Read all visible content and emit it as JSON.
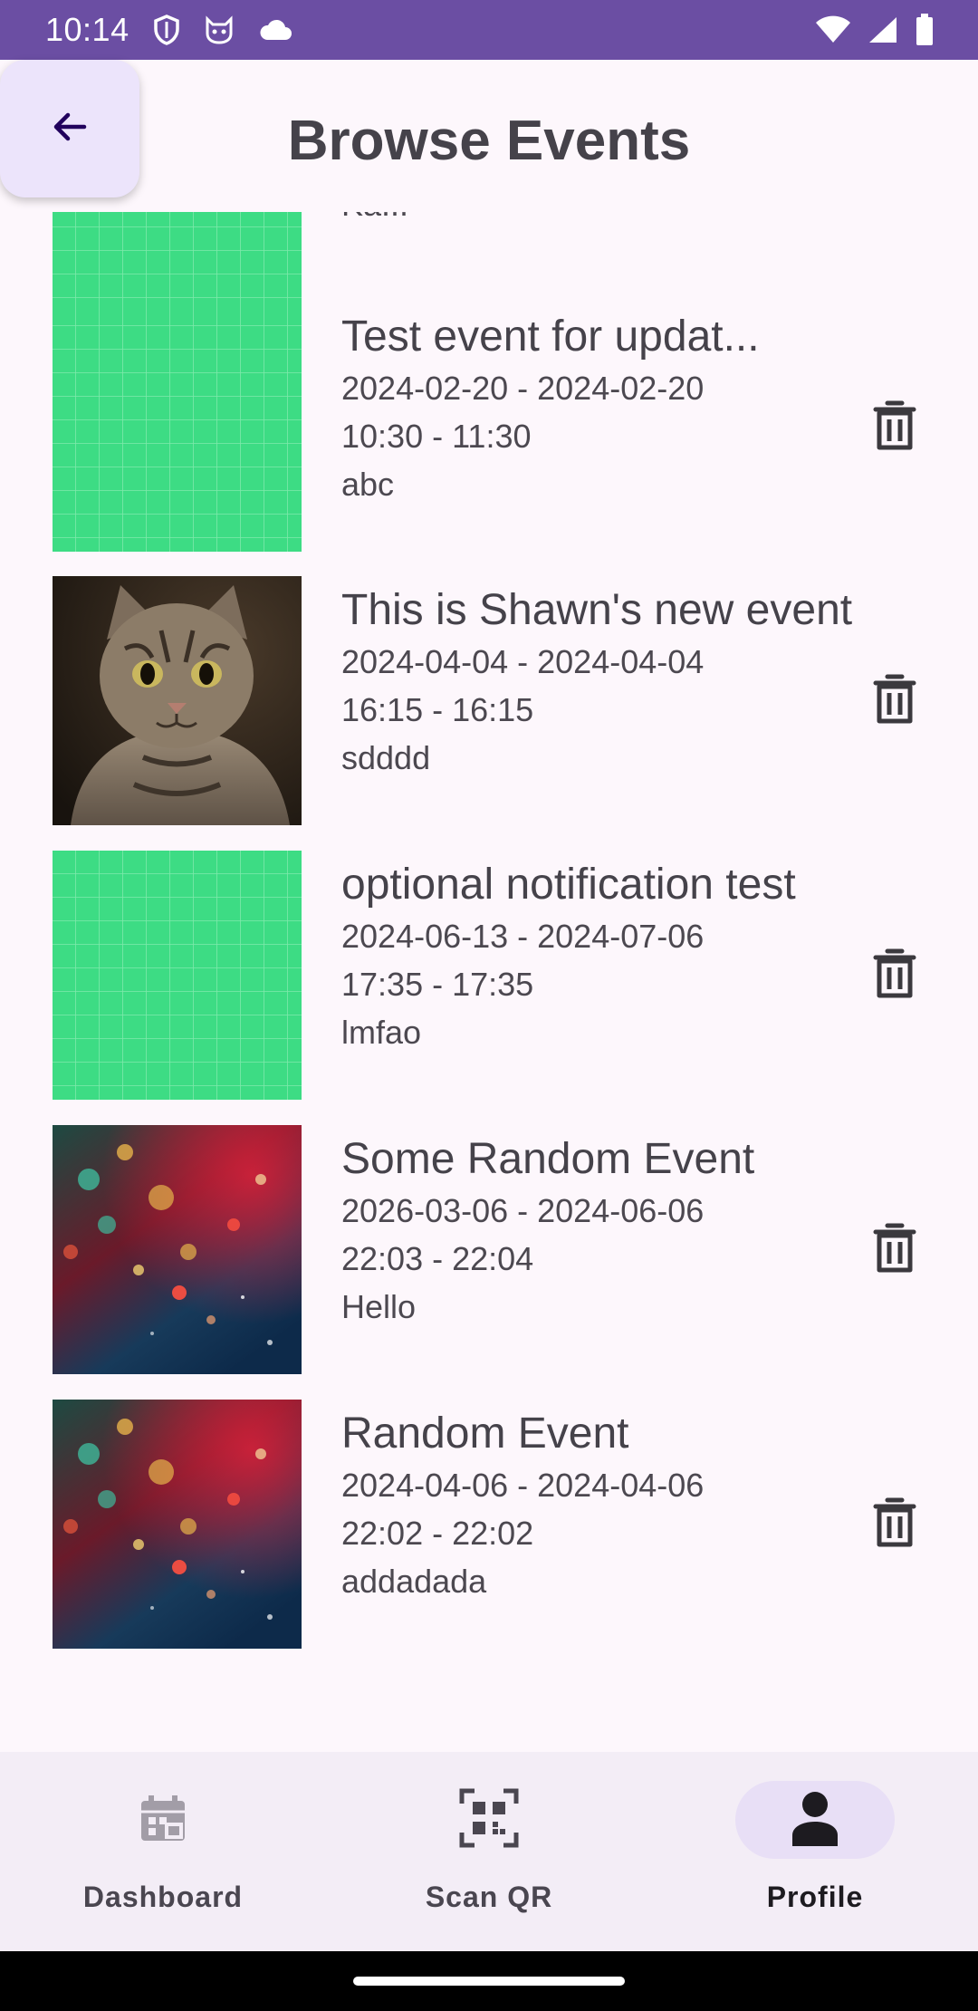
{
  "status_bar": {
    "time": "10:14",
    "left_icons": [
      "shield-icon",
      "cat-face-icon",
      "cloud-icon"
    ],
    "right_icons": [
      "wifi-icon",
      "signal-icon",
      "battery-icon"
    ],
    "background_color": "#6b4ea3"
  },
  "header": {
    "back_icon": "arrow-back-icon",
    "title": "Browse Events"
  },
  "events": [
    {
      "title": "Ka...",
      "dates": "",
      "times": "",
      "location": "",
      "image": "green-grid-placeholder",
      "partially_visible": true
    },
    {
      "title": "Test event for updat...",
      "dates": "2024-02-20 - 2024-02-20",
      "times": "10:30 - 11:30",
      "location": "abc",
      "image": "green-grid-placeholder"
    },
    {
      "title": "This is Shawn's new event",
      "dates": "2024-04-04 - 2024-04-04",
      "times": "16:15 - 16:15",
      "location": "sdddd",
      "image": "cat-photo"
    },
    {
      "title": "optional notification test",
      "dates": "2024-06-13 - 2024-07-06",
      "times": "17:35 - 17:35",
      "location": "lmfao",
      "image": "green-grid-placeholder"
    },
    {
      "title": "Some Random Event",
      "dates": "2026-03-06 - 2024-06-06",
      "times": "22:03 - 22:04",
      "location": "Hello",
      "image": "bokeh-photo"
    },
    {
      "title": "Random Event",
      "dates": "2024-04-06 - 2024-04-06",
      "times": "22:02 - 22:02",
      "location": "addadada",
      "image": "bokeh-photo"
    }
  ],
  "delete_icon": "trash-icon",
  "bottom_nav": {
    "items": [
      {
        "label": "Dashboard",
        "icon": "calendar-icon",
        "active": false
      },
      {
        "label": "Scan QR",
        "icon": "qr-scan-icon",
        "active": false
      },
      {
        "label": "Profile",
        "icon": "person-icon",
        "active": true
      }
    ]
  },
  "colors": {
    "background": "#fdf7fc",
    "placeholder_green": "#3ddc84",
    "active_pill": "#e8dff6",
    "back_button": "#ece4fb"
  }
}
